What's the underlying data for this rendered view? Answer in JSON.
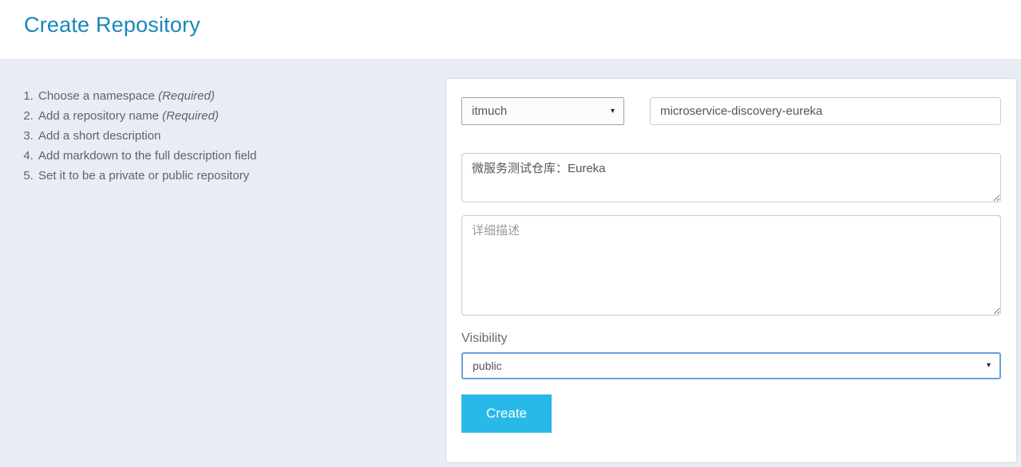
{
  "header": {
    "title": "Create Repository"
  },
  "instructions": {
    "items": [
      {
        "text": "Choose a namespace ",
        "note": "(Required)"
      },
      {
        "text": "Add a repository name ",
        "note": "(Required)"
      },
      {
        "text": "Add a short description",
        "note": ""
      },
      {
        "text": "Add markdown to the full description field",
        "note": ""
      },
      {
        "text": "Set it to be a private or public repository",
        "note": ""
      }
    ]
  },
  "form": {
    "namespace_select": {
      "value": "itmuch"
    },
    "repo_name_input": {
      "value": "microservice-discovery-eureka"
    },
    "short_description": {
      "value": "微服务测试仓库：Eureka"
    },
    "full_description": {
      "placeholder": "详细描述"
    },
    "visibility_label": "Visibility",
    "visibility_select": {
      "value": "public"
    },
    "create_button_label": "Create"
  },
  "icons": {
    "dropdown_caret": "▾"
  },
  "colors": {
    "title_blue": "#1987b9",
    "button_cyan": "#29b9e9",
    "focus_border_blue": "#6ba0d8",
    "page_background": "#e8edf4"
  }
}
